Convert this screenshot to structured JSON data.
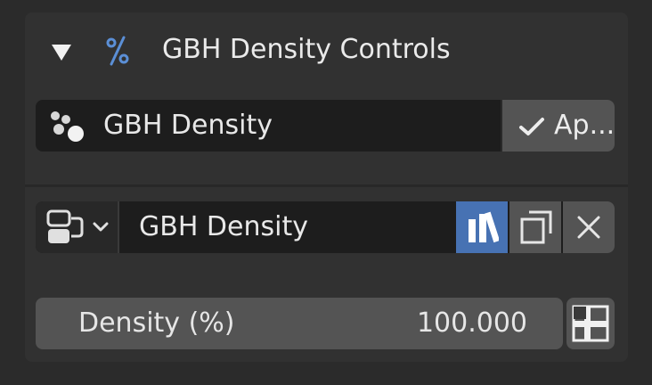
{
  "panel": {
    "title": "GBH Density Controls",
    "collapse_icon": "disclosure-triangle-down-icon",
    "panel_icon": "percent-icon"
  },
  "attribute_row": {
    "icon": "point-cloud-icon",
    "name": "GBH Density",
    "apply_label": "Ap...",
    "apply_icon": "checkmark-icon"
  },
  "datablock_row": {
    "browse_icon": "node-tree-icon",
    "dropdown_icon": "chevron-down-icon",
    "name": "GBH Density",
    "fake_user_icon": "fake-user-icon",
    "duplicate_icon": "duplicate-icon",
    "unlink_icon": "close-icon",
    "accent_color": "#4772b3"
  },
  "density": {
    "label": "Density (%)",
    "value": "100.000",
    "keyframe_icon": "decorate-keyframe-icon"
  }
}
